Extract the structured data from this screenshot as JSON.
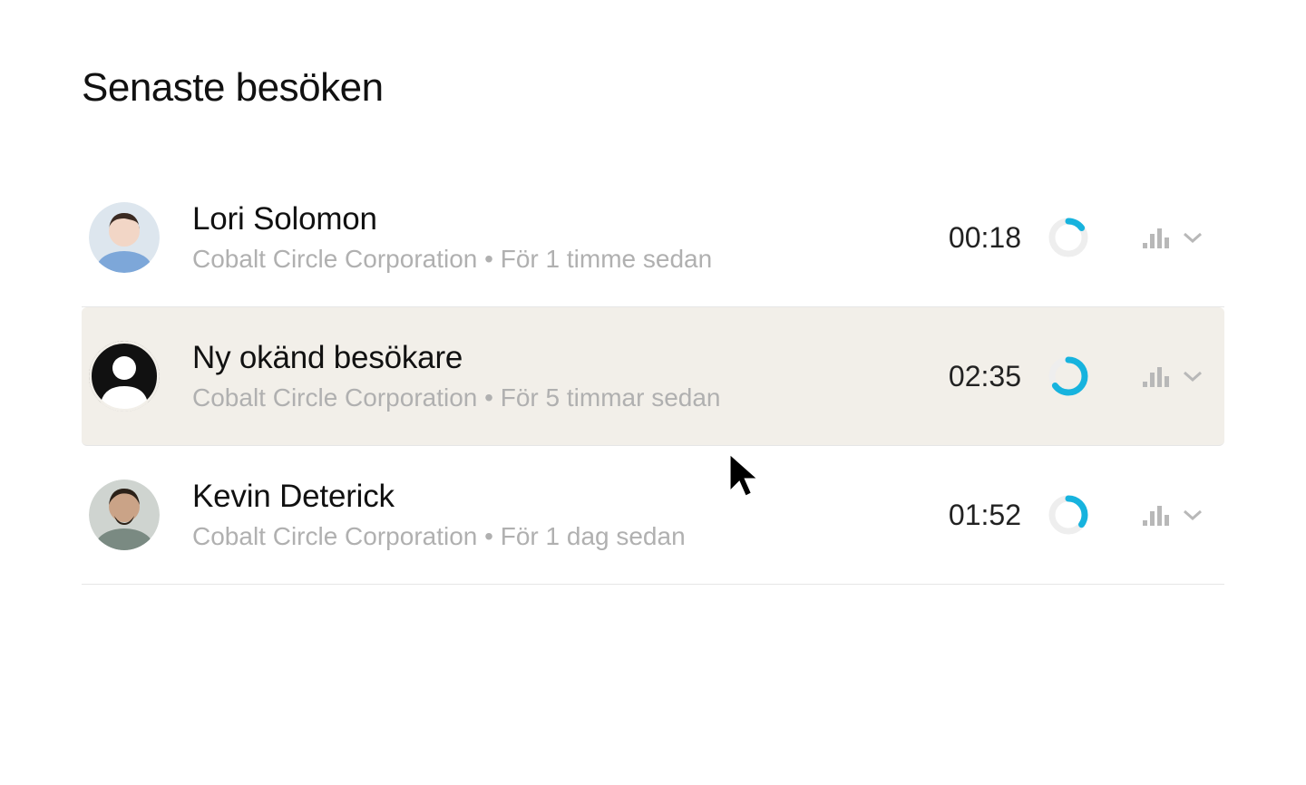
{
  "colors": {
    "accent": "#17b3de",
    "muted": "#b0b0b0",
    "hover_bg": "#f2efe9"
  },
  "header": {
    "title": "Senaste besöken"
  },
  "visits": [
    {
      "name": "Lori Solomon",
      "company": "Cobalt Circle Corporation",
      "time_ago": "För 1 timme sedan",
      "duration": "00:18",
      "progress_pct": 15,
      "avatar_type": "photo",
      "hover": false
    },
    {
      "name": "Ny okänd besökare",
      "company": "Cobalt Circle Corporation",
      "time_ago": "För 5 timmar sedan",
      "duration": "02:35",
      "progress_pct": 65,
      "avatar_type": "silhouette",
      "hover": true
    },
    {
      "name": "Kevin Deterick",
      "company": "Cobalt Circle Corporation",
      "time_ago": "För 1 dag sedan",
      "duration": "01:52",
      "progress_pct": 35,
      "avatar_type": "photo",
      "hover": false
    }
  ]
}
